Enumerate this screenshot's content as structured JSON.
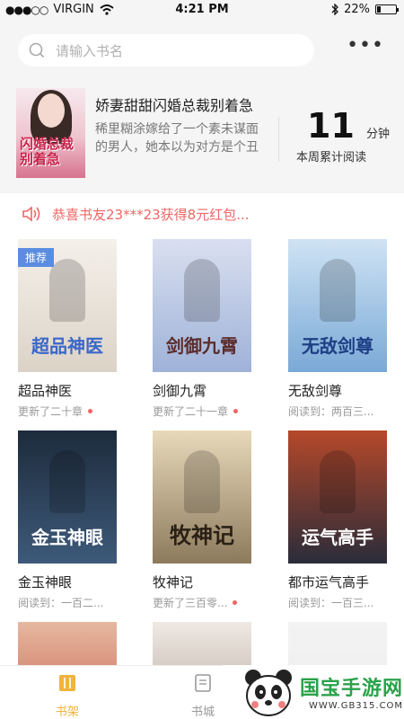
{
  "status": {
    "carrier": "VIRGIN",
    "time": "4:21 PM",
    "battery": "22%",
    "battery_level": 0.22
  },
  "search": {
    "placeholder": "请输入书名"
  },
  "recent": {
    "cover_title": "闪婚总裁别着急",
    "title": "娇妻甜甜闪婚总裁别着急",
    "description": "稀里糊涂嫁给了一个素未谋面的男人，她本以为对方是个丑八怪，不想跟自己碰..."
  },
  "weekly": {
    "minutes": "11",
    "unit": "分钟",
    "label": "本周累计阅读"
  },
  "notice": {
    "text": "恭喜书友23***23获得8元红包..."
  },
  "books": [
    {
      "title": "超品神医",
      "status": "更新了二十章",
      "unread": true,
      "badge": "推荐",
      "cover_text": "超品神医",
      "colors": [
        "#f4f0ea",
        "#dcd3c7"
      ],
      "text_color": "#3a67c9"
    },
    {
      "title": "剑御九霄",
      "status": "更新了二十一章",
      "unread": true,
      "badge": "",
      "cover_text": "剑御九霄",
      "colors": [
        "#d9dff0",
        "#9fb2d8"
      ],
      "text_color": "#5b2c2c"
    },
    {
      "title": "无敌剑尊",
      "status": "阅读到：两百三...",
      "unread": false,
      "badge": "",
      "cover_text": "无敌剑尊",
      "colors": [
        "#cfe3f4",
        "#7aa9d6"
      ],
      "text_color": "#1e3f85"
    },
    {
      "title": "金玉神眼",
      "status": "阅读到：一百二...",
      "unread": false,
      "badge": "",
      "cover_text": "金玉神眼",
      "colors": [
        "#1d2b3c",
        "#3e5a7a"
      ],
      "text_color": "#ffffff"
    },
    {
      "title": "牧神记",
      "status": "更新了三百零...",
      "unread": true,
      "badge": "",
      "cover_text": "牧神记",
      "colors": [
        "#e8d9bb",
        "#8d7a5c"
      ],
      "text_color": "#2a2016"
    },
    {
      "title": "都市运气高手",
      "status": "阅读到：一百三...",
      "unread": false,
      "badge": "",
      "cover_text": "运气高手",
      "colors": [
        "#b5482a",
        "#2a2c3a"
      ],
      "text_color": "#ffffff"
    },
    {
      "title": "",
      "status": "",
      "unread": false,
      "badge": "",
      "cover_text": "",
      "colors": [
        "#e6b8a0",
        "#c04a3b"
      ],
      "text_color": "#ffffff"
    },
    {
      "title": "",
      "status": "",
      "unread": false,
      "badge": "",
      "cover_text": "",
      "colors": [
        "#efe9e3",
        "#a6968a"
      ],
      "text_color": "#ffffff"
    },
    {
      "title": "",
      "status": "",
      "unread": false,
      "badge": "",
      "cover_text": "",
      "colors": [
        "#f3f3f3",
        "#ececec"
      ],
      "text_color": "#ffffff"
    }
  ],
  "tabs": [
    {
      "label": "书架",
      "active": true
    },
    {
      "label": "书城",
      "active": false
    }
  ],
  "watermark": {
    "title": "国宝手游网",
    "url": "WWW.GB315.COM"
  },
  "colors": {
    "accent": "#f0b33c",
    "notice": "#f06565",
    "badge": "#5a8de0"
  }
}
